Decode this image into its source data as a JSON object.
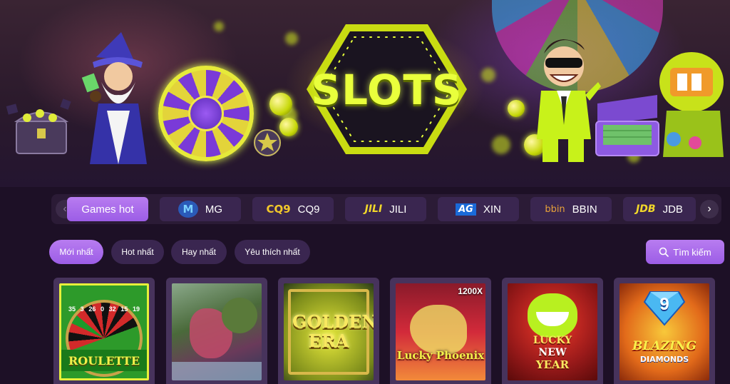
{
  "hero": {
    "title": "SLOTS"
  },
  "providers": [
    {
      "label": "Games hot",
      "logo": "",
      "active": true
    },
    {
      "label": "MG",
      "logo": "M",
      "active": false
    },
    {
      "label": "CQ9",
      "logo": "CQ9",
      "active": false
    },
    {
      "label": "JILI",
      "logo": "JILI",
      "active": false
    },
    {
      "label": "XIN",
      "logo": "AG",
      "active": false
    },
    {
      "label": "BBIN",
      "logo": "bbin",
      "active": false
    },
    {
      "label": "JDB",
      "logo": "JDB",
      "active": false
    }
  ],
  "filters": [
    {
      "label": "Mới nhất",
      "active": true
    },
    {
      "label": "Hot nhất",
      "active": false
    },
    {
      "label": "Hay nhất",
      "active": false
    },
    {
      "label": "Yêu thích nhất",
      "active": false
    }
  ],
  "search": {
    "label": "Tìm kiếm"
  },
  "games": [
    {
      "title": "ROULETTE",
      "wheel_numbers": [
        "35",
        "3",
        "26",
        "0",
        "32",
        "15",
        "19"
      ]
    },
    {
      "title": ""
    },
    {
      "title": "GOLDEN ERA"
    },
    {
      "title": "Lucky Phoenix",
      "multiplier": "1200X"
    },
    {
      "title": "LUCKY NEW YEAR",
      "title_lines": [
        "LUCKY",
        "NEW",
        "YEAR"
      ]
    },
    {
      "title": "BLAZING",
      "subtitle": "DIAMONDS",
      "number": "9"
    }
  ],
  "colors": {
    "accent": "#a86ceb",
    "background": "#1d1026",
    "tab": "#3a2650",
    "card": "#47335c",
    "neon": "#e9ff3c"
  }
}
